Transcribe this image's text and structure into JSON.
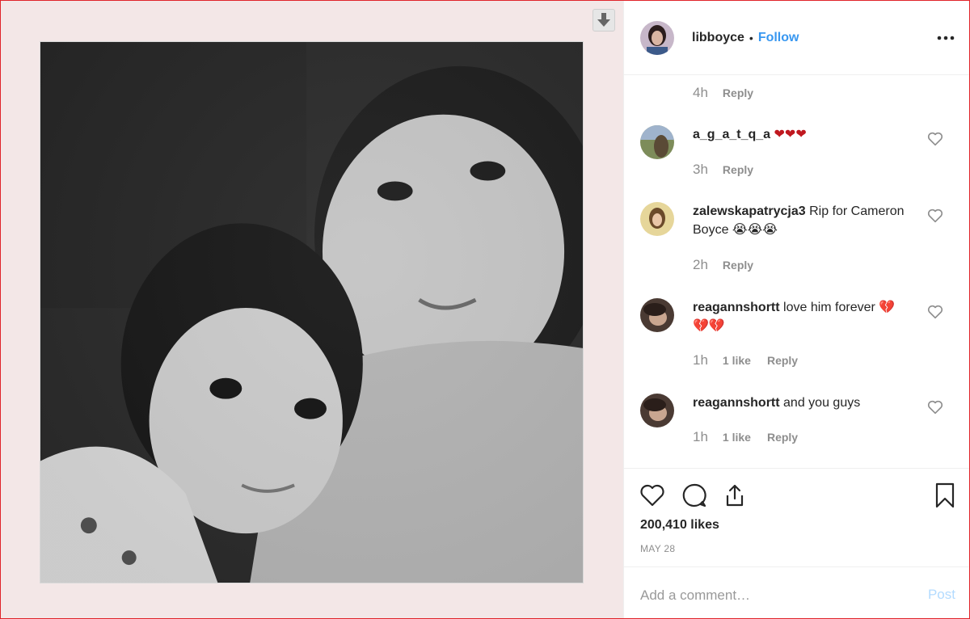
{
  "post": {
    "username": "libboyce",
    "separator": "•",
    "follow_label": "Follow",
    "more_icon": "more-horizontal-icon",
    "likes": "200,410 likes",
    "date": "MAY 28"
  },
  "comments": {
    "first_meta": {
      "time": "4h",
      "reply": "Reply"
    },
    "items": [
      {
        "user": "a_g_a_t_q_a",
        "text": "❤❤❤",
        "time": "3h",
        "likes": "",
        "reply": "Reply"
      },
      {
        "user": "zalewskapatrycja3",
        "text": "Rip for Cameron Boyce 😭😭😭",
        "time": "2h",
        "likes": "",
        "reply": "Reply"
      },
      {
        "user": "reagannshortt",
        "text": "love him forever 💔💔💔",
        "time": "1h",
        "likes": "1 like",
        "reply": "Reply"
      },
      {
        "user": "reagannshortt",
        "text": "and you guys",
        "time": "1h",
        "likes": "1 like",
        "reply": "Reply"
      }
    ]
  },
  "actions": {
    "like_icon": "heart-icon",
    "comment_icon": "comment-icon",
    "share_icon": "share-icon",
    "save_icon": "bookmark-icon"
  },
  "composer": {
    "placeholder": "Add a comment…",
    "post_label": "Post"
  },
  "colors": {
    "accent": "#3897f0",
    "post_disabled": "#b3dbff",
    "media_bg": "#f3e7e7",
    "frame_border": "#e0242a"
  }
}
